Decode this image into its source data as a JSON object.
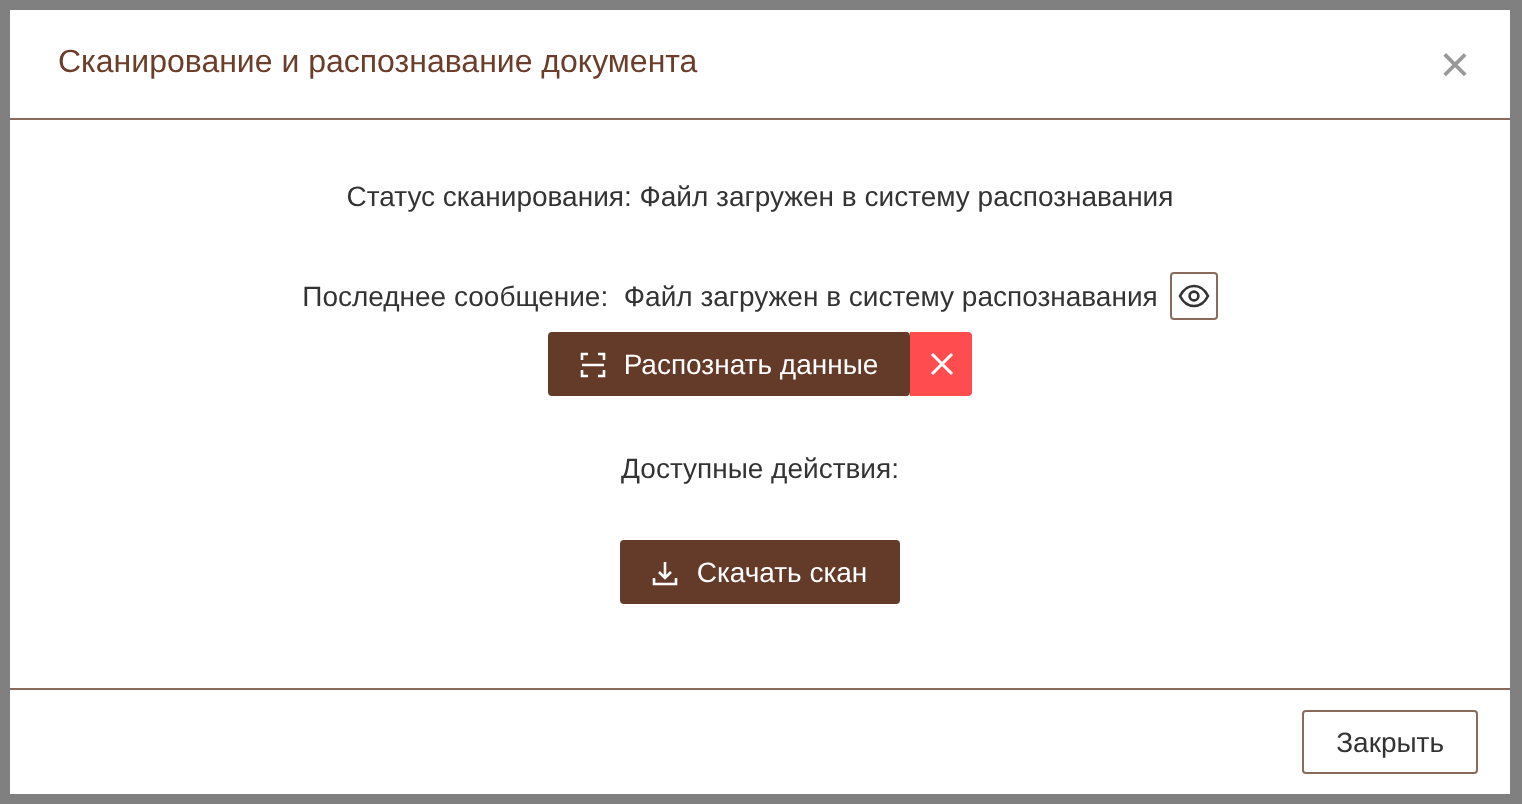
{
  "dialog": {
    "title": "Сканирование и распознавание документа",
    "close_icon": "×"
  },
  "status": {
    "label": "Статус сканирования:",
    "value": "Файл загружен в систему распознавания"
  },
  "last_message": {
    "label": "Последнее сообщение:",
    "value": "Файл загружен в систему распознавания"
  },
  "recognize_button": {
    "label": "Распознать данные"
  },
  "actions_label": "Доступные действия:",
  "download_button": {
    "label": "Скачать скан"
  },
  "footer": {
    "close_button": "Закрыть"
  }
}
